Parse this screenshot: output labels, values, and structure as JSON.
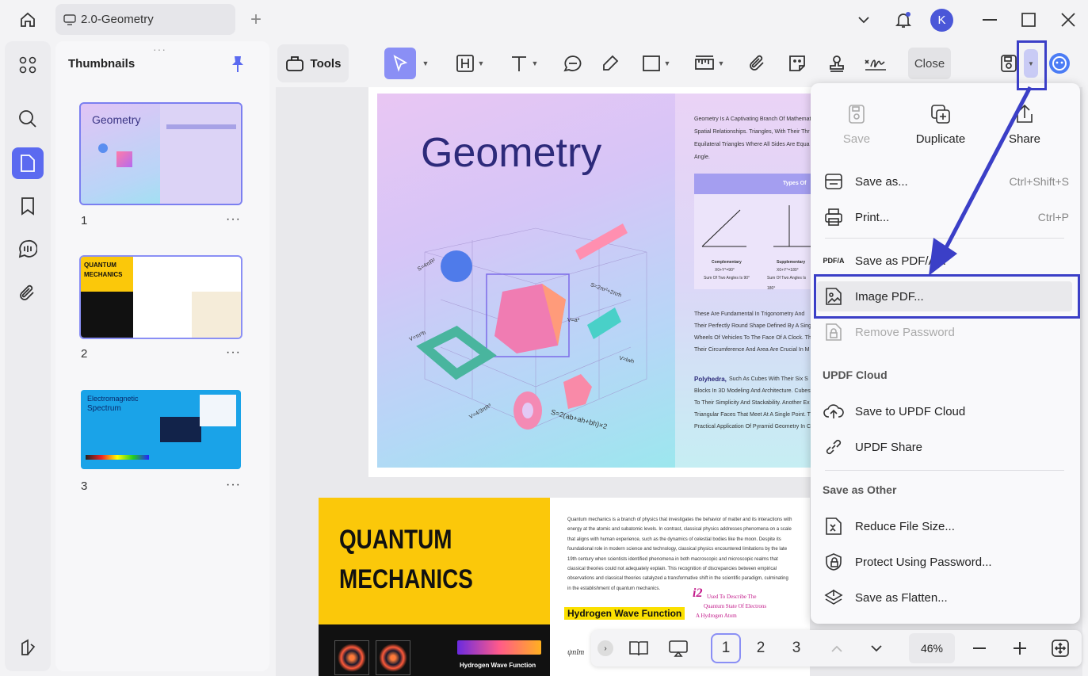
{
  "tab": {
    "title": "2.0-Geometry"
  },
  "avatar_letter": "K",
  "sidebar": {
    "title": "Thumbnails",
    "pages": [
      {
        "num": "1",
        "more": "···"
      },
      {
        "num": "2",
        "more": "···"
      },
      {
        "num": "3",
        "more": "···"
      }
    ],
    "thumb_labels": {
      "p1": "Geometry",
      "p2a": "QUANTUM",
      "p2b": "MECHANICS",
      "p3a": "Electromagnetic",
      "p3b": "Spectrum"
    }
  },
  "toolbar": {
    "tools_label": "Tools",
    "close_label": "Close"
  },
  "page1": {
    "title": "Geometry",
    "intro": [
      "Geometry Is A Captivating Branch Of Mathemat",
      "Spatial Relationships. Triangles, With Their Thr",
      "Equilateral Triangles Where All Sides Are Equa",
      "Angle."
    ],
    "table_header": "Types Of",
    "comp_label": "Complementary",
    "comp_eq": "X0+Y°=90°",
    "comp_sum": "Sum Of Two Angles Is 90°",
    "supp_label": "Supplementary",
    "supp_eq": "X0+Y°=180°",
    "supp_sum": "Sum Of Two Angles Is 180°",
    "para2": [
      "These Are Fundamental In Trigonometry And",
      "Their Perfectly Round Shape Defined By A Sing",
      "Wheels Of Vehicles To The Face Of A Clock. Th",
      "Their Circumference And Area Are Crucial In M"
    ],
    "poly_bold": "Polyhedra,",
    "para3": [
      " Such As Cubes With Their Six S",
      "Blocks In 3D Modeling And Architecture. Cubes",
      "To Their Simplicity And Stackability. Another Ex",
      "Triangular Faces That Meet At A Single Point. T",
      "Practical Application Of Pyramid Geometry In C"
    ],
    "formulas": {
      "f1": "S=4πR²",
      "f2": "S=2πr²+2πrh",
      "f3": "V=a³",
      "f4": "V=lwh",
      "f5": "V=4/3πR³",
      "f6": "V=πr²h",
      "f7": "S=2(ab+ah+bh)×2"
    }
  },
  "page2": {
    "title1": "QUANTUM",
    "title2": "MECHANICS",
    "body": [
      "Quantum mechanics is a branch of physics that investigates the behavior of matter and its interactions with",
      "energy at the atomic and subatomic levels. In contrast, classical physics addresses phenomena on a scale",
      "that aligns with human experience, such as the dynamics of celestial bodies like the moon. Despite its",
      "foundational role in modern science and technology, classical physics encountered limitations by the late",
      "19th century when scientists identified phenomena in both macroscopic and microscopic realms that",
      "classical theories could not adequately explain. This recognition of discrepancies between empirical",
      "observations and classical theories catalyzed a transformative shift in the scientific paradigm, culminating",
      "in the establishment of quantum mechanics."
    ],
    "hwf": "Hydrogen Wave Function",
    "hwf2": "Hydrogen Wave Function",
    "note_i2": "i2",
    "note1": "Used To Describe The",
    "note2": "Quantum State Of Electrons",
    "note3": "A Hydrogen Atom",
    "psi": "ψnlm"
  },
  "menu": {
    "top": {
      "save": "Save",
      "duplicate": "Duplicate",
      "share": "Share"
    },
    "items": [
      {
        "label": "Save as...",
        "shortcut": "Ctrl+Shift+S"
      },
      {
        "label": "Print...",
        "shortcut": "Ctrl+P"
      },
      {
        "label": "Save as PDF/A..."
      },
      {
        "label": "Image PDF..."
      },
      {
        "label": "Remove Password"
      }
    ],
    "cloud_header": "UPDF Cloud",
    "cloud_items": [
      {
        "label": "Save to UPDF Cloud"
      },
      {
        "label": "UPDF Share"
      }
    ],
    "other_header": "Save as Other",
    "other_items": [
      {
        "label": "Reduce File Size..."
      },
      {
        "label": "Protect Using Password..."
      },
      {
        "label": "Save as Flatten..."
      }
    ],
    "pdfa_icon_text": "PDF/A"
  },
  "bottombar": {
    "pages": [
      "1",
      "2",
      "3"
    ],
    "zoom": "46%"
  },
  "colors": {
    "accent": "#5b6af0",
    "highlight": "#3b3fc7",
    "yellow": "#fbc80a"
  }
}
